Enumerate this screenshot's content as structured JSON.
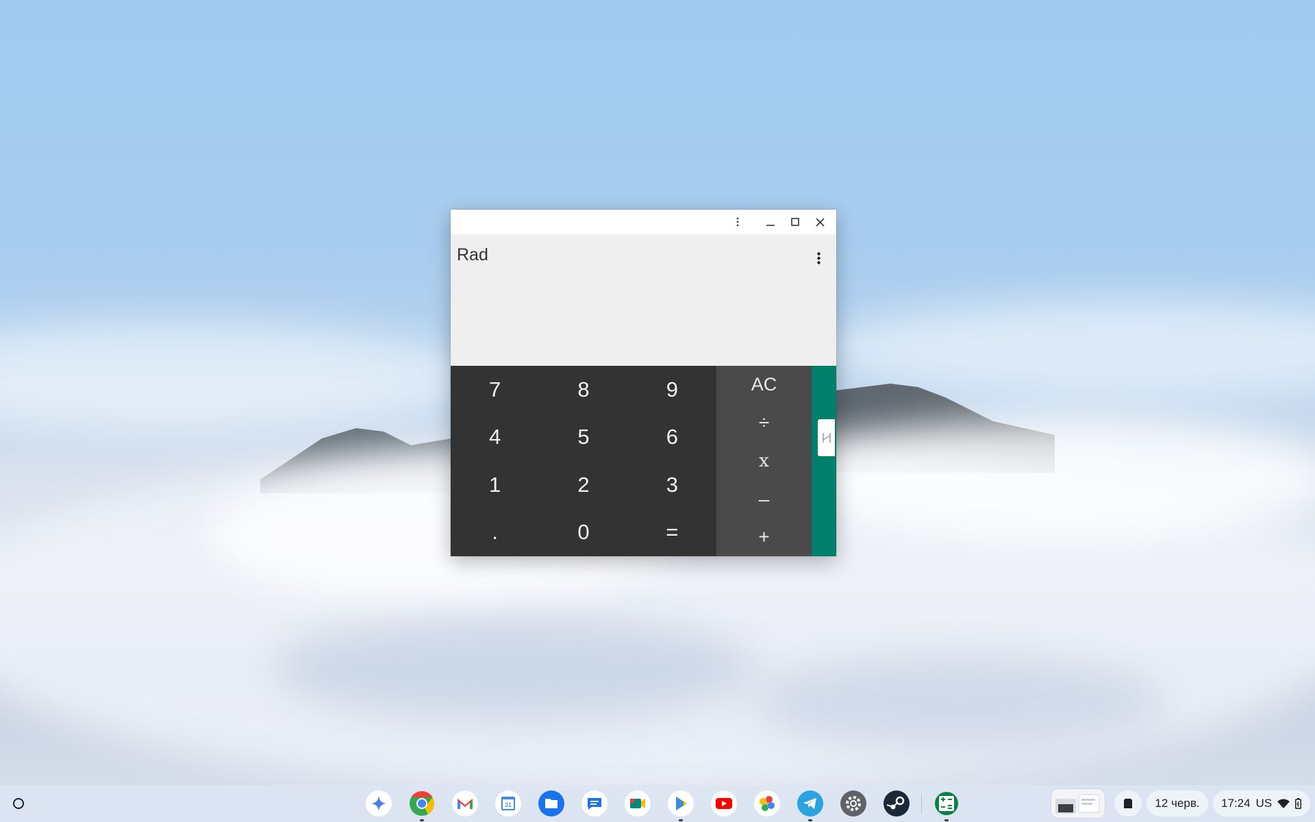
{
  "window": {
    "titlebar": {
      "menu_icon": "more-vert-icon",
      "minimize_icon": "minimize-icon",
      "maximize_icon": "maximize-icon",
      "close_icon": "close-icon"
    },
    "display": {
      "mode_label": "Rad",
      "menu_icon": "more-vert-icon"
    },
    "keypad": {
      "digits": [
        "7",
        "8",
        "9",
        "4",
        "5",
        "6",
        "1",
        "2",
        "3",
        ".",
        "0",
        "="
      ],
      "operators": [
        "AC",
        "÷",
        "x",
        "–",
        "+"
      ]
    },
    "advanced_panel": {
      "handle_icon": "advanced-functions-icon",
      "color": "#00806b"
    }
  },
  "shelf": {
    "launcher_icon": "launcher-icon",
    "apps": [
      {
        "name": "gemini",
        "icon": "gemini-icon"
      },
      {
        "name": "chrome",
        "icon": "chrome-icon"
      },
      {
        "name": "gmail",
        "icon": "gmail-icon"
      },
      {
        "name": "calendar",
        "icon": "calendar-icon",
        "label": "31"
      },
      {
        "name": "files",
        "icon": "files-icon"
      },
      {
        "name": "messages",
        "icon": "messages-icon"
      },
      {
        "name": "meet",
        "icon": "meet-icon"
      },
      {
        "name": "play-store",
        "icon": "play-store-icon"
      },
      {
        "name": "youtube",
        "icon": "youtube-icon"
      },
      {
        "name": "photos",
        "icon": "photos-icon"
      },
      {
        "name": "telegram",
        "icon": "telegram-icon"
      },
      {
        "name": "settings",
        "icon": "settings-icon"
      },
      {
        "name": "steam",
        "icon": "steam-icon"
      },
      {
        "name": "calculator",
        "icon": "calculator-icon"
      }
    ],
    "tray": {
      "holding_space_icon": "holding-space-icon",
      "date": "12 черв.",
      "time": "17:24",
      "keyboard_layout": "US",
      "wifi_icon": "wifi-icon",
      "battery_icon": "battery-icon"
    }
  }
}
